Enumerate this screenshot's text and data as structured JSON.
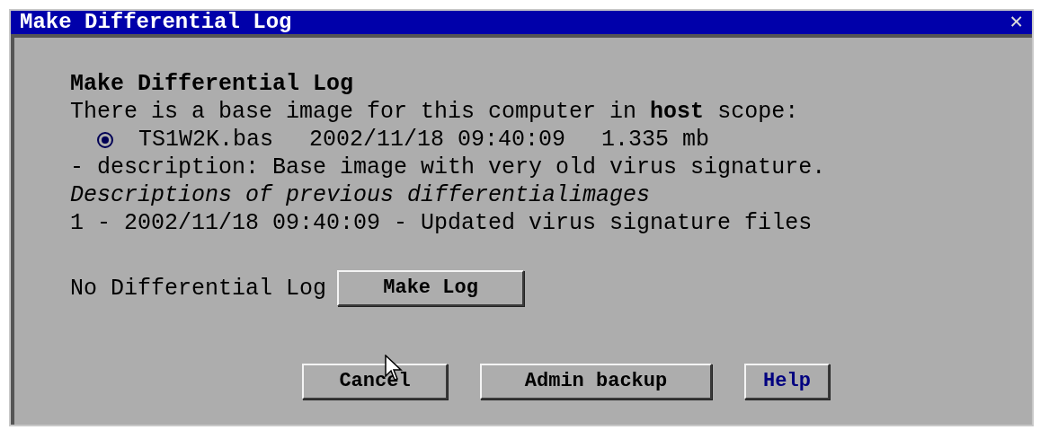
{
  "window": {
    "title": "Make Differential Log",
    "close": "✕"
  },
  "heading": "Make Differential Log",
  "intro": "There is a base image for this computer in **host** scope:",
  "base_image": {
    "selected": true,
    "file": "TS1W2K.bas",
    "date": "2002/11/18 09:40:09",
    "size": "1.335 mb"
  },
  "description": "- description: Base image with very old virus signature.",
  "previous_heading": "Descriptions of previous differentialimages",
  "previous": [
    "1 - 2002/11/18 09:40:09 - Updated virus signature files"
  ],
  "log_status": "No Differential Log",
  "make_log_button": "Make Log",
  "buttons": [
    {
      "label": "Cancel",
      "kind": "normal"
    },
    {
      "label": "Admin backup",
      "kind": "normal"
    },
    {
      "label": "Help",
      "kind": "help"
    }
  ]
}
